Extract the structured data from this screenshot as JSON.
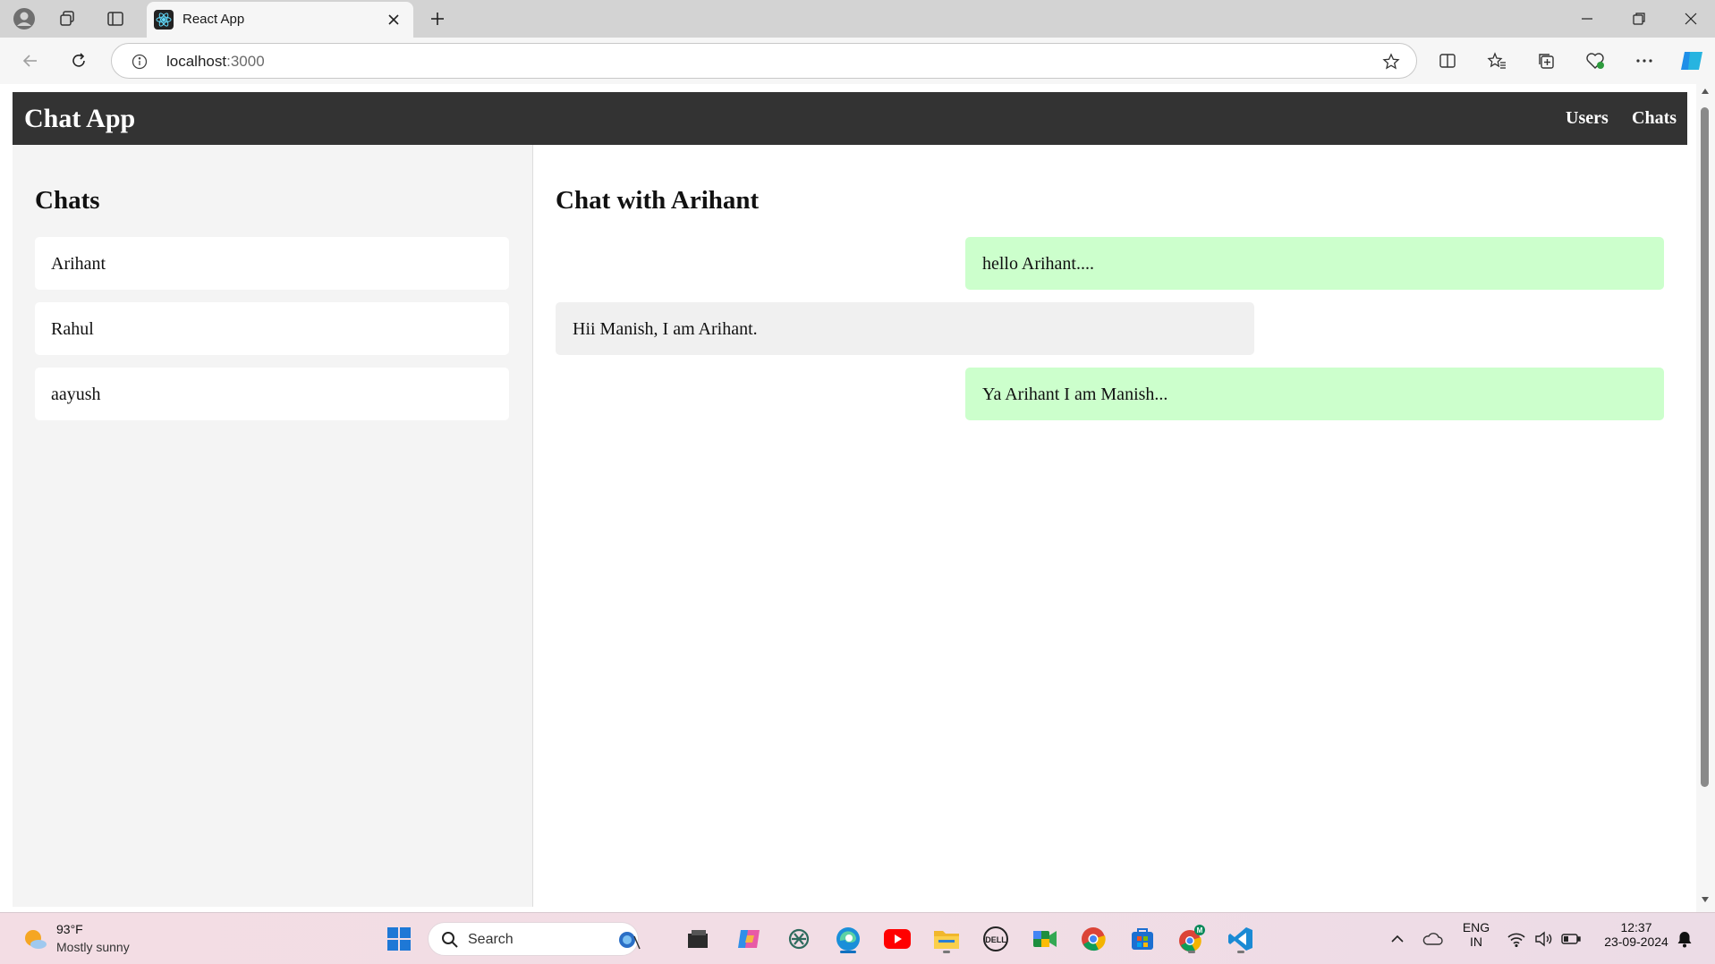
{
  "browser": {
    "tab_title": "React App",
    "url_host": "localhost",
    "url_port": ":3000"
  },
  "app": {
    "title": "Chat App",
    "nav": [
      "Users",
      "Chats"
    ]
  },
  "sidebar": {
    "title": "Chats",
    "items": [
      {
        "label": "Arihant"
      },
      {
        "label": "Rahul"
      },
      {
        "label": "aayush"
      }
    ]
  },
  "chat": {
    "title": "Chat with Arihant",
    "messages": [
      {
        "text": "hello Arihant....",
        "sender": "me"
      },
      {
        "text": "Hii Manish, I am Arihant.",
        "sender": "other"
      },
      {
        "text": "Ya Arihant I am Manish...",
        "sender": "me"
      }
    ]
  },
  "colors": {
    "header_bg": "#333333",
    "sent_bubble": "#ccffcc",
    "received_bubble": "#f0f0f0",
    "sidebar_bg": "#f4f4f4"
  },
  "taskbar": {
    "weather_temp": "93°F",
    "weather_desc": "Mostly sunny",
    "search_label": "Search",
    "lang_line1": "ENG",
    "lang_line2": "IN",
    "time": "12:37",
    "date": "23-09-2024",
    "apps": [
      "widgets-icon",
      "start-icon",
      "file-manager-icon",
      "copilot-icon",
      "chatgpt-icon",
      "edge-icon",
      "youtube-icon",
      "file-explorer-icon",
      "dell-icon",
      "meet-icon",
      "chrome-icon",
      "store-icon",
      "chrome-profile-icon",
      "vscode-icon"
    ]
  }
}
